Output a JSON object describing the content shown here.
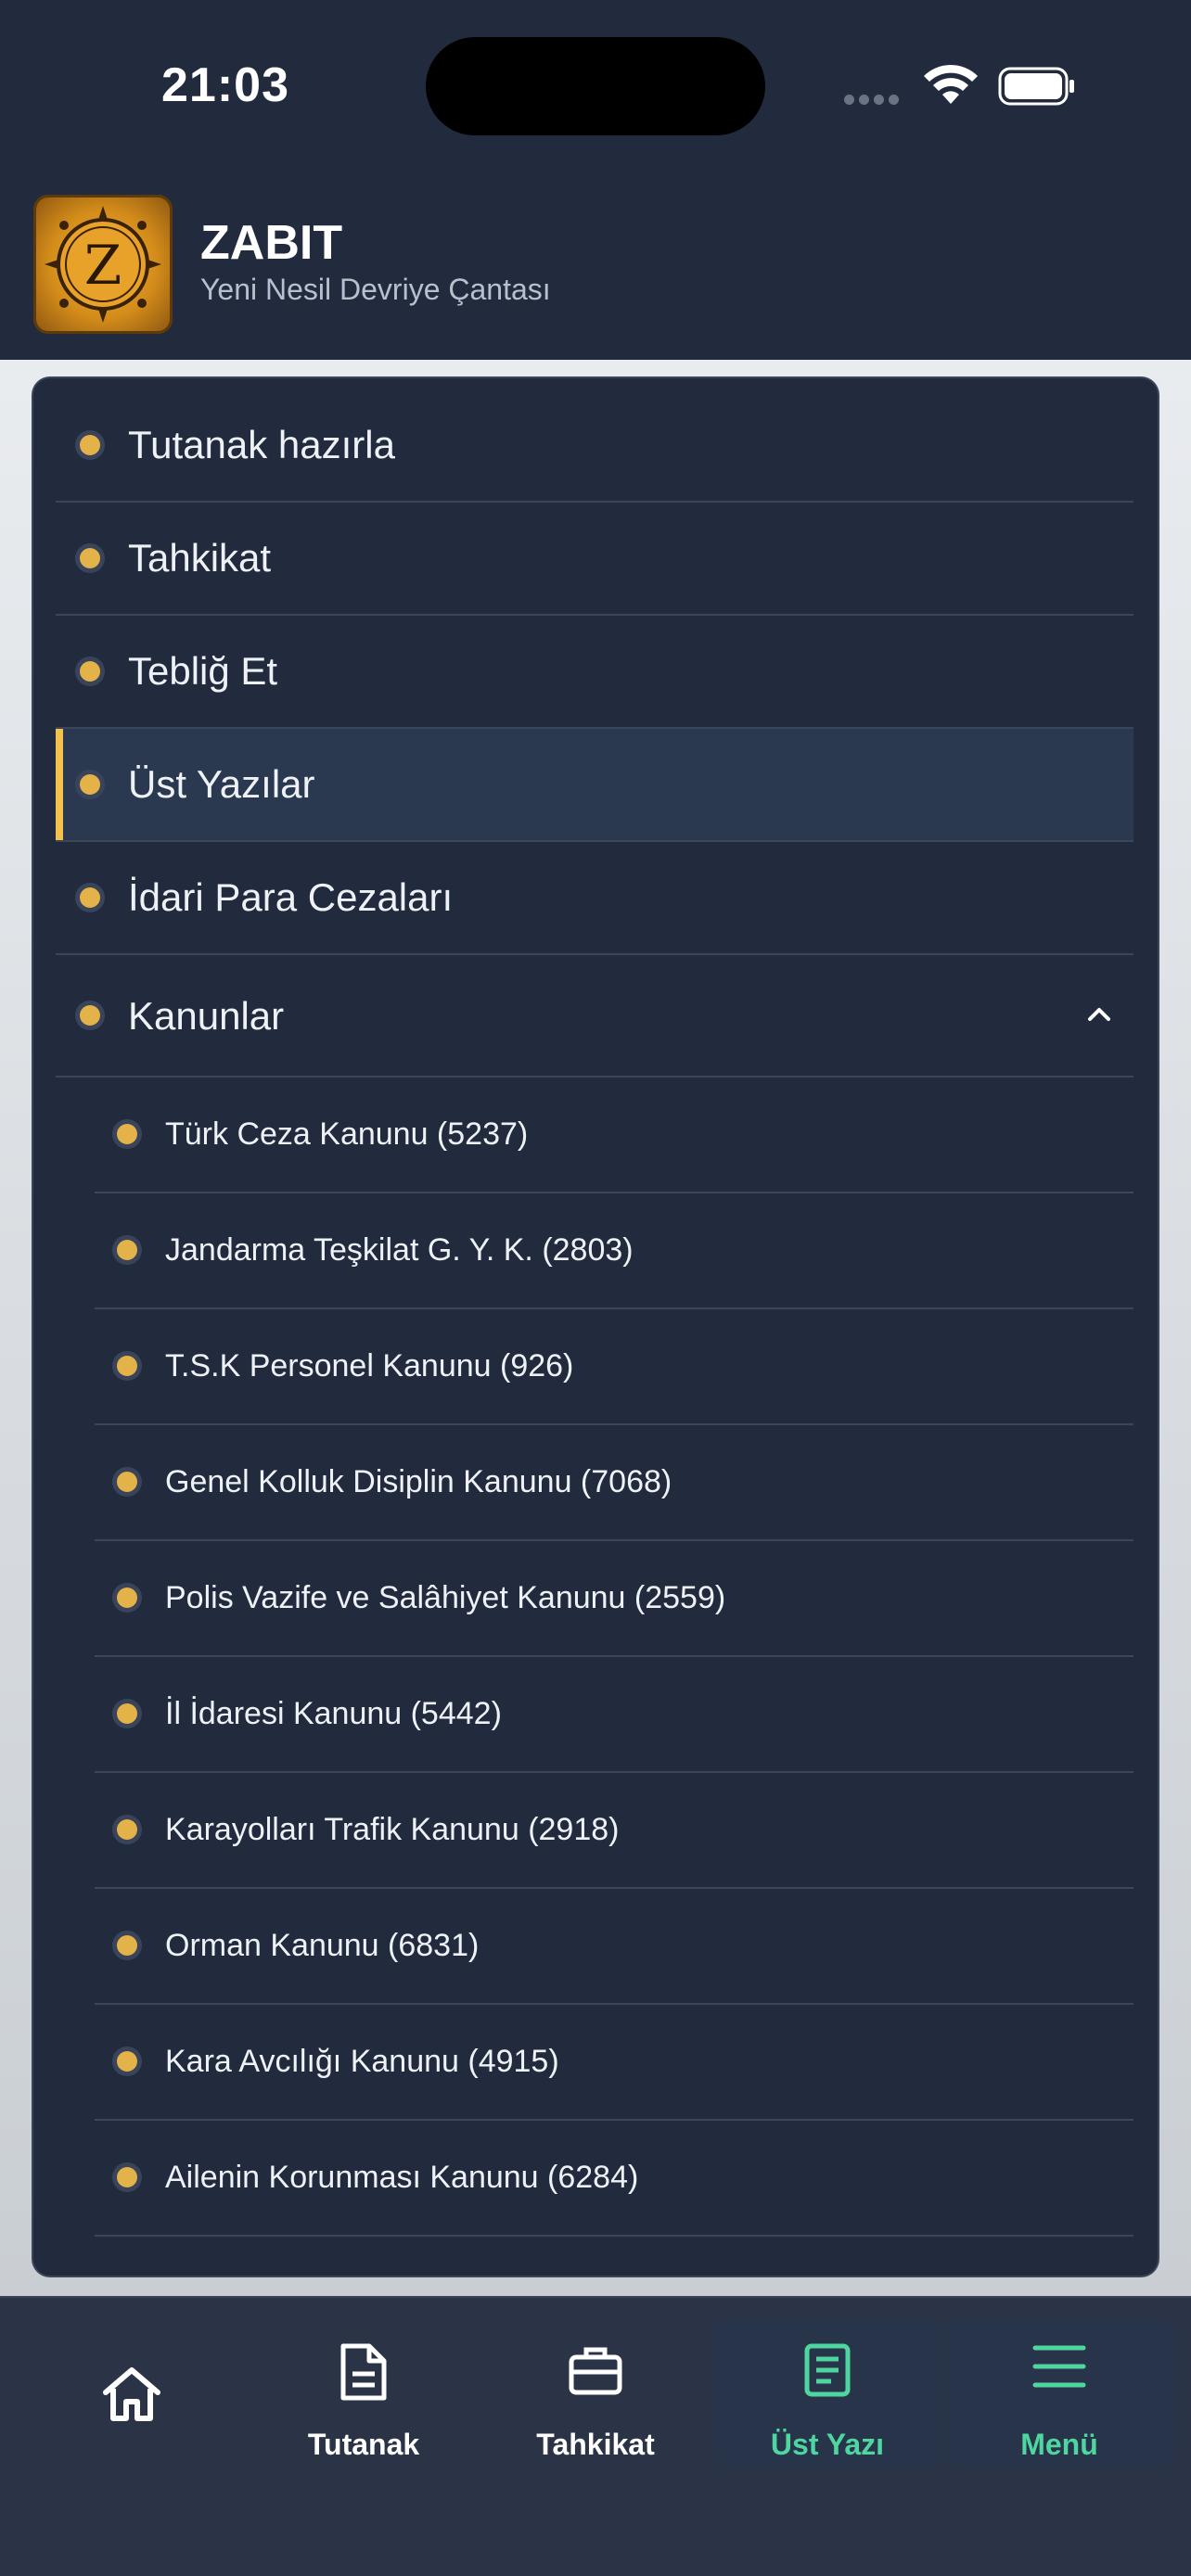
{
  "status_bar": {
    "time": "21:03"
  },
  "header": {
    "title": "ZABIT",
    "subtitle": "Yeni Nesil Devriye Çantası",
    "logo_letter": "Z"
  },
  "menu": {
    "items": [
      {
        "label": "Tutanak hazırla"
      },
      {
        "label": "Tahkikat"
      },
      {
        "label": "Tebliğ Et"
      },
      {
        "label": "Üst Yazılar",
        "active": true
      },
      {
        "label": "İdari Para Cezaları"
      },
      {
        "label": "Kanunlar",
        "expanded": true
      }
    ],
    "laws": [
      {
        "label": "Türk Ceza Kanunu (5237)"
      },
      {
        "label": "Jandarma Teşkilat G. Y. K. (2803)"
      },
      {
        "label": "T.S.K Personel Kanunu (926)"
      },
      {
        "label": "Genel Kolluk Disiplin Kanunu (7068)"
      },
      {
        "label": "Polis Vazife ve Salâhiyet Kanunu (2559)"
      },
      {
        "label": "İl İdaresi Kanunu (5442)"
      },
      {
        "label": "Karayolları Trafik Kanunu (2918)"
      },
      {
        "label": "Orman Kanunu (6831)"
      },
      {
        "label": "Kara Avcılığı Kanunu (4915)"
      },
      {
        "label": "Ailenin Korunması Kanunu (6284)"
      }
    ]
  },
  "bottom_nav": {
    "items": [
      {
        "label": "",
        "icon": "home-icon"
      },
      {
        "label": "Tutanak",
        "icon": "document-icon"
      },
      {
        "label": "Tahkikat",
        "icon": "briefcase-icon"
      },
      {
        "label": "Üst Yazı",
        "icon": "note-icon",
        "active": true
      },
      {
        "label": "Menü",
        "icon": "hamburger-icon"
      }
    ]
  },
  "colors": {
    "accent": "#f2c14e",
    "bullet": "#e3b34a",
    "nav_active": "#4fd6a0",
    "panel": "#222b3d"
  }
}
